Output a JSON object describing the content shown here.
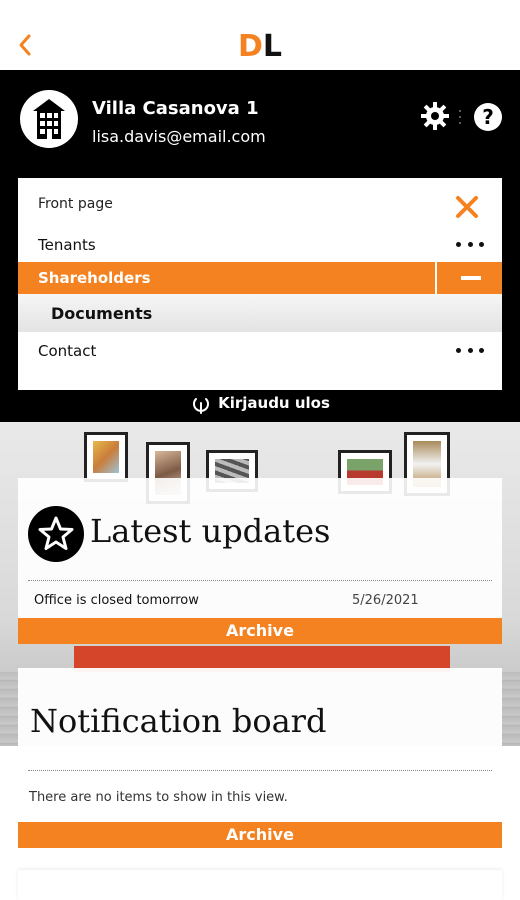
{
  "app": {
    "logo_left": "D",
    "logo_right": "L",
    "accent_color": "#f58220"
  },
  "header": {
    "property_name": "Villa Casanova 1",
    "email": "lisa.davis@email.com",
    "settings_icon": "gear-icon",
    "help_label": "?",
    "avatar_icon": "building-icon"
  },
  "menu": {
    "front_page": "Front page",
    "items": [
      {
        "label": "Tenants",
        "state": "collapsed"
      },
      {
        "label": "Shareholders",
        "state": "expanded",
        "selected": true
      },
      {
        "label": "Documents",
        "state": "child"
      },
      {
        "label": "Contact",
        "state": "collapsed"
      }
    ],
    "logout": "Kirjaudu ulos"
  },
  "updates": {
    "title": "Latest updates",
    "items": [
      {
        "title": "Office is closed tomorrow",
        "date": "5/26/2021"
      }
    ],
    "archive": "Archive"
  },
  "notifications": {
    "title": "Notification board",
    "empty": "There are no items to show in this view.",
    "archive": "Archive"
  }
}
